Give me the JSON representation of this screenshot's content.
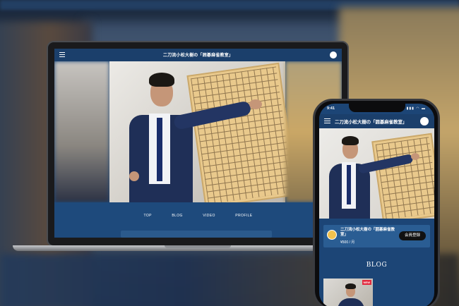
{
  "site": {
    "title": "二刀流小松大樹の「囲碁麻雀教室」"
  },
  "laptop": {
    "nav": [
      "TOP",
      "BLOG",
      "VIDEO",
      "PROFILE"
    ]
  },
  "phone": {
    "status_time": "9:41",
    "status_icons": "▮▮▮ ◠ ▬",
    "title": "二刀流小松大樹の「囲碁麻雀教室」",
    "membership": {
      "title": "二刀流小松大樹の「囲碁麻雀教室」",
      "price": "¥500 / 月",
      "button_label": "会員登録"
    },
    "section_heading": "BLOG",
    "new_badge": "NEW"
  },
  "colors": {
    "header": "#1b3f6b",
    "page": "#1e4a7c",
    "card": "#2a5d93",
    "badge": "#e2293d"
  }
}
